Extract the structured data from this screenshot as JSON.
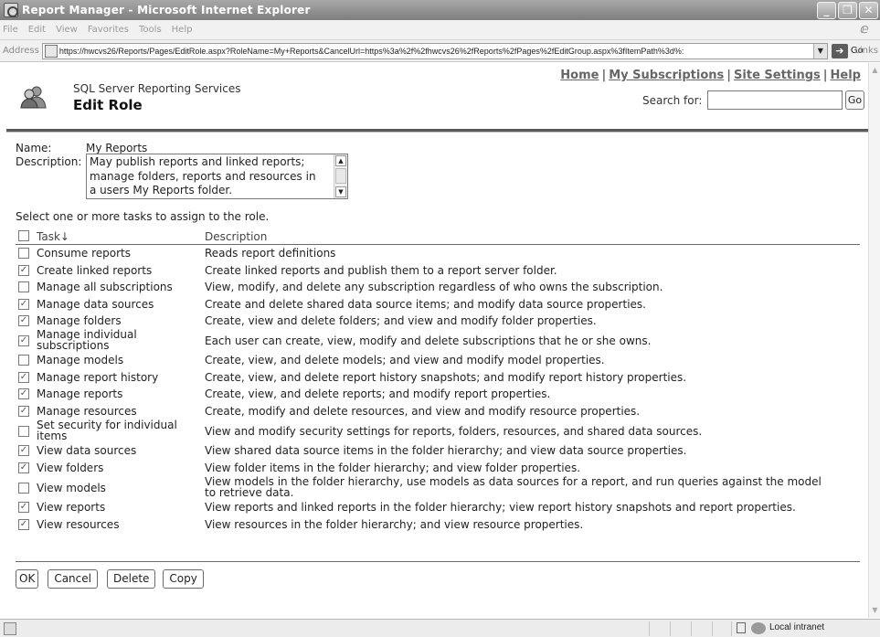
{
  "window": {
    "title": "Report Manager - Microsoft Internet Explorer"
  },
  "menu": [
    "File",
    "Edit",
    "View",
    "Favorites",
    "Tools",
    "Help"
  ],
  "address": {
    "label": "Address",
    "url": "https://hwcvs26/Reports/Pages/EditRole.aspx?RoleName=My+Reports&CancelUrl=https%3a%2f%2fhwcvs26%2fReports%2fPages%2fEditGroup.aspx%3fItemPath%3d%:",
    "go_label": "Go",
    "links_label": "Links"
  },
  "header": {
    "links": [
      "Home",
      "My Subscriptions",
      "Site Settings",
      "Help"
    ],
    "product": "SQL Server Reporting Services",
    "title": "Edit Role",
    "search_label": "Search for:",
    "search_value": "",
    "search_go": "Go"
  },
  "role": {
    "name_label": "Name:",
    "name": "My Reports",
    "description_label": "Description:",
    "description": "May publish reports and linked reports;\nmanage folders, reports and resources in\na users My Reports folder."
  },
  "instructions": "Select one or more tasks to assign to the role.",
  "table": {
    "header_task": "Task↓",
    "header_description": "Description",
    "rows": [
      {
        "task": "Consume reports",
        "description": "Reads report definitions",
        "checked": false
      },
      {
        "task": "Create linked reports",
        "description": "Create linked reports and publish them to a report server folder.",
        "checked": true
      },
      {
        "task": "Manage all subscriptions",
        "description": "View, modify, and delete any subscription regardless of who owns the subscription.",
        "checked": false
      },
      {
        "task": "Manage data sources",
        "description": "Create and delete shared data source items; and modify data source properties.",
        "checked": true
      },
      {
        "task": "Manage folders",
        "description": "Create, view and delete folders; and view and modify folder properties.",
        "checked": true
      },
      {
        "task": "Manage individual\nsubscriptions",
        "description": "Each user can create, view, modify and delete subscriptions that he or she owns.",
        "checked": true
      },
      {
        "task": "Manage models",
        "description": "Create, view, and delete models; and view and modify model properties.",
        "checked": false
      },
      {
        "task": "Manage report history",
        "description": "Create, view, and delete report history snapshots; and modify report history properties.",
        "checked": true
      },
      {
        "task": "Manage reports",
        "description": "Create, view, and delete reports; and modify report properties.",
        "checked": true
      },
      {
        "task": "Manage resources",
        "description": "Create, modify and delete resources, and view and modify resource properties.",
        "checked": true
      },
      {
        "task": "Set security for individual\nitems",
        "description": "View and modify security settings for reports, folders, resources, and shared data sources.",
        "checked": false
      },
      {
        "task": "View data sources",
        "description": "View shared data source items in the folder hierarchy; and view data source properties.",
        "checked": true
      },
      {
        "task": "View folders",
        "description": "View folder items in the folder hierarchy; and view folder properties.",
        "checked": true
      },
      {
        "task": "View models",
        "description": "View models in the folder hierarchy, use models as data sources for a report, and run queries against the model\nto retrieve data.",
        "checked": false
      },
      {
        "task": "View reports",
        "description": "View reports and linked reports in the folder hierarchy; view report history snapshots and report properties.",
        "checked": true
      },
      {
        "task": "View resources",
        "description": "View resources in the folder hierarchy; and view resource properties.",
        "checked": true
      }
    ]
  },
  "buttons": {
    "ok": "OK",
    "cancel": "Cancel",
    "delete": "Delete",
    "copy": "Copy"
  },
  "status": {
    "zone": "Local intranet"
  }
}
